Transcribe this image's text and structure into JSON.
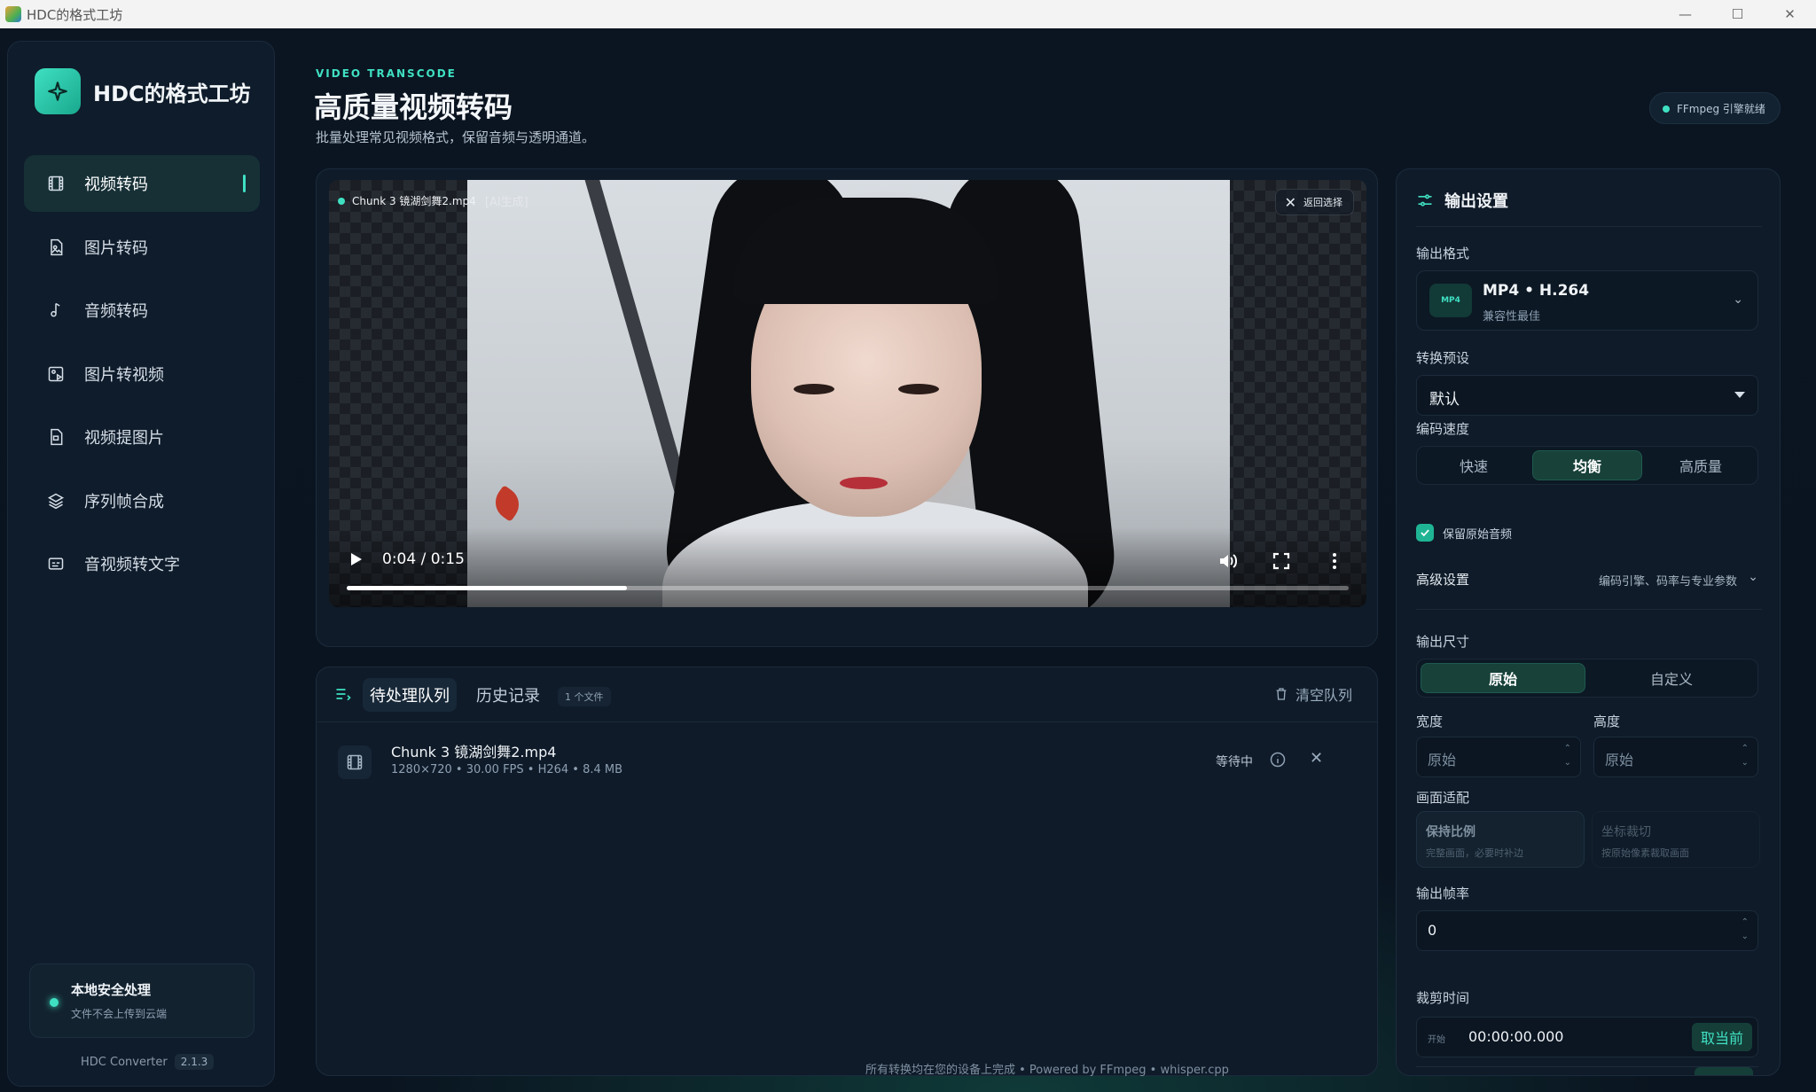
{
  "window": {
    "title": "HDC的格式工坊"
  },
  "brand": {
    "name": "HDC的格式工坊"
  },
  "sidebar": {
    "items": [
      {
        "label": "视频转码",
        "icon": "film-icon"
      },
      {
        "label": "图片转码",
        "icon": "image-file-icon"
      },
      {
        "label": "音频转码",
        "icon": "music-note-icon"
      },
      {
        "label": "图片转视频",
        "icon": "image-to-video-icon"
      },
      {
        "label": "视频提图片",
        "icon": "video-to-image-icon"
      },
      {
        "label": "序列帧合成",
        "icon": "layers-icon"
      },
      {
        "label": "音视频转文字",
        "icon": "subtitles-icon"
      }
    ],
    "active_index": 0,
    "safe": {
      "title": "本地安全处理",
      "subtitle": "文件不会上传到云端"
    },
    "version": {
      "name": "HDC Converter",
      "number": "2.1.3"
    }
  },
  "header": {
    "eyebrow": "VIDEO TRANSCODE",
    "title": "高质量视频转码",
    "subtitle": "批量处理常见视频格式，保留音频与透明通道。",
    "engine_status": "FFmpeg 引擎就绪"
  },
  "player": {
    "file_name": "Chunk 3 镜湖剑舞2.mp4",
    "ai_tag": "[AI生成]",
    "back_label": "返回选择",
    "time": "0:04 / 0:15",
    "progress": 0.28
  },
  "queue": {
    "tabs": [
      "待处理队列",
      "历史记录"
    ],
    "count": "1 个文件",
    "clear_label": "清空队列",
    "items": [
      {
        "name": "Chunk 3 镜湖剑舞2.mp4",
        "meta": "1280×720 • 30.00 FPS • H264 • 8.4 MB",
        "status": "等待中"
      }
    ]
  },
  "footer": {
    "text": "所有转换均在您的设备上完成  •  Powered by FFmpeg  •  whisper.cpp"
  },
  "settings": {
    "title": "输出设置",
    "format_label": "输出格式",
    "format": {
      "chip": "MP4",
      "title": "MP4 • H.264",
      "subtitle": "兼容性最佳"
    },
    "preset_label": "转换预设",
    "preset_value": "默认",
    "speed_label": "编码速度",
    "speed_options": [
      "快速",
      "均衡",
      "高质量"
    ],
    "speed_selected": "均衡",
    "keep_audio": {
      "label": "保留原始音频",
      "checked": true
    },
    "advanced": {
      "title": "高级设置",
      "desc": "编码引擎、码率与专业参数"
    },
    "size_label": "输出尺寸",
    "size_options": [
      "原始",
      "自定义"
    ],
    "size_selected": "原始",
    "width_label": "宽度",
    "width_value": "原始",
    "height_label": "高度",
    "height_value": "原始",
    "fit_label": "画面适配",
    "fit_options": [
      {
        "title": "保持比例",
        "subtitle": "完整画面，必要时补边"
      },
      {
        "title": "坐标裁切",
        "subtitle": "按原始像素裁取画面"
      }
    ],
    "fps_label": "输出帧率",
    "fps_value": "0",
    "trim_label": "裁剪时间",
    "trim_start_prefix": "开始",
    "trim_start_value": "00:00:00.000",
    "trim_start_button": "取当前"
  },
  "colors": {
    "accent": "#3fe0c2",
    "background": "#0b1622",
    "panel": "#0f1b29"
  }
}
